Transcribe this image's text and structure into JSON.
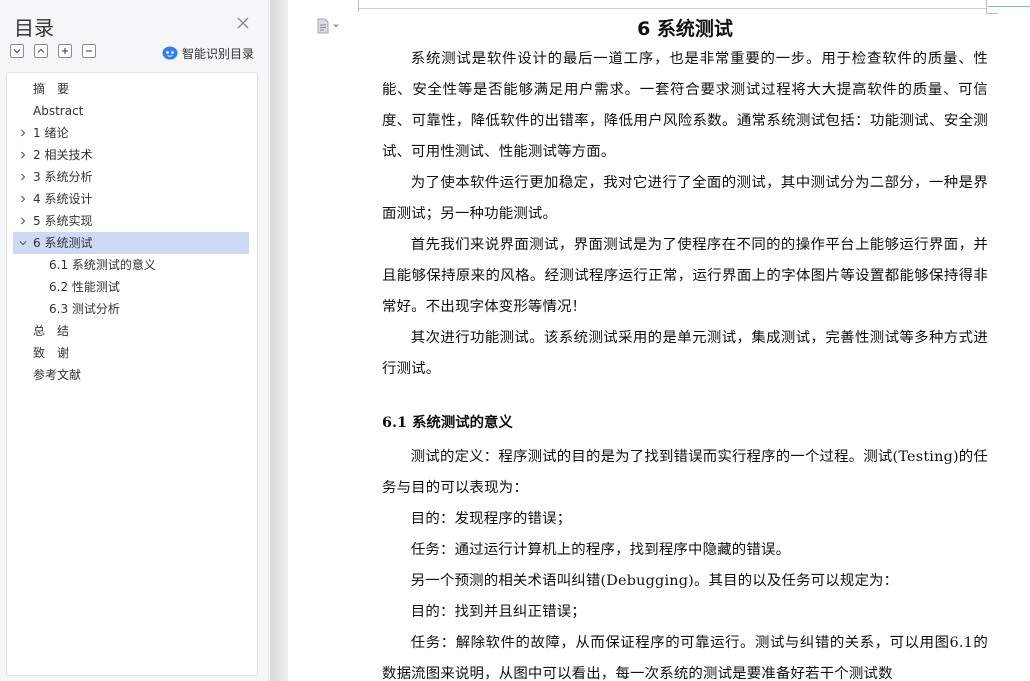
{
  "sidebar": {
    "title": "目录",
    "smart_recognize_label": "智能识别目录",
    "toc": [
      {
        "label": "摘　要",
        "level": 0,
        "caret": "none",
        "active": false
      },
      {
        "label": "Abstract",
        "level": 0,
        "caret": "none",
        "active": false
      },
      {
        "label": "1 绪论",
        "level": 0,
        "caret": "right",
        "active": false
      },
      {
        "label": "2 相关技术",
        "level": 0,
        "caret": "right",
        "active": false
      },
      {
        "label": "3 系统分析",
        "level": 0,
        "caret": "right",
        "active": false
      },
      {
        "label": "4 系统设计",
        "level": 0,
        "caret": "right",
        "active": false
      },
      {
        "label": "5 系统实现",
        "level": 0,
        "caret": "right",
        "active": false
      },
      {
        "label": "6 系统测试",
        "level": 0,
        "caret": "down",
        "active": true
      },
      {
        "label": "6.1 系统测试的意义",
        "level": 1,
        "caret": "none",
        "active": false
      },
      {
        "label": "6.2 性能测试",
        "level": 1,
        "caret": "none",
        "active": false
      },
      {
        "label": "6.3 测试分析",
        "level": 1,
        "caret": "none",
        "active": false
      },
      {
        "label": "总　结",
        "level": 0,
        "caret": "none",
        "active": false
      },
      {
        "label": "致　谢",
        "level": 0,
        "caret": "none",
        "active": false
      },
      {
        "label": "参考文献",
        "level": 0,
        "caret": "none",
        "active": false
      }
    ]
  },
  "document": {
    "title": "6 系统测试",
    "paragraphs_before": [
      "系统测试是软件设计的最后一道工序，也是非常重要的一步。用于检查软件的质量、性能、安全性等是否能够满足用户需求。一套符合要求测试过程将大大提高软件的质量、可信度、可靠性，降低软件的出错率，降低用户风险系数。通常系统测试包括：功能测试、安全测试、可用性测试、性能测试等方面。",
      "为了使本软件运行更加稳定，我对它进行了全面的测试，其中测试分为二部分，一种是界面测试；另一种功能测试。",
      "首先我们来说界面测试，界面测试是为了使程序在不同的的操作平台上能够运行界面，并且能够保持原来的风格。经测试程序运行正常，运行界面上的字体图片等设置都能够保持得非常好。不出现字体变形等情况！",
      "其次进行功能测试。该系统测试采用的是单元测试，集成测试，完善性测试等多种方式进行测试。"
    ],
    "section_heading": "6.1 系统测试的意义",
    "paragraphs_after": [
      "测试的定义：程序测试的目的是为了找到错误而实行程序的一个过程。测试(Testing)的任务与目的可以表现为：",
      "目的：发现程序的错误；",
      "任务：通过运行计算机上的程序，找到程序中隐藏的错误。",
      "另一个预测的相关术语叫纠错(Debugging)。其目的以及任务可以规定为：",
      "目的：找到并且纠正错误；",
      "任务：解除软件的故障，从而保证程序的可靠运行。测试与纠错的关系，可以用图6.1的数据流图来说明，从图中可以看出，每一次系统的测试是要准备好若干个测试数"
    ]
  }
}
